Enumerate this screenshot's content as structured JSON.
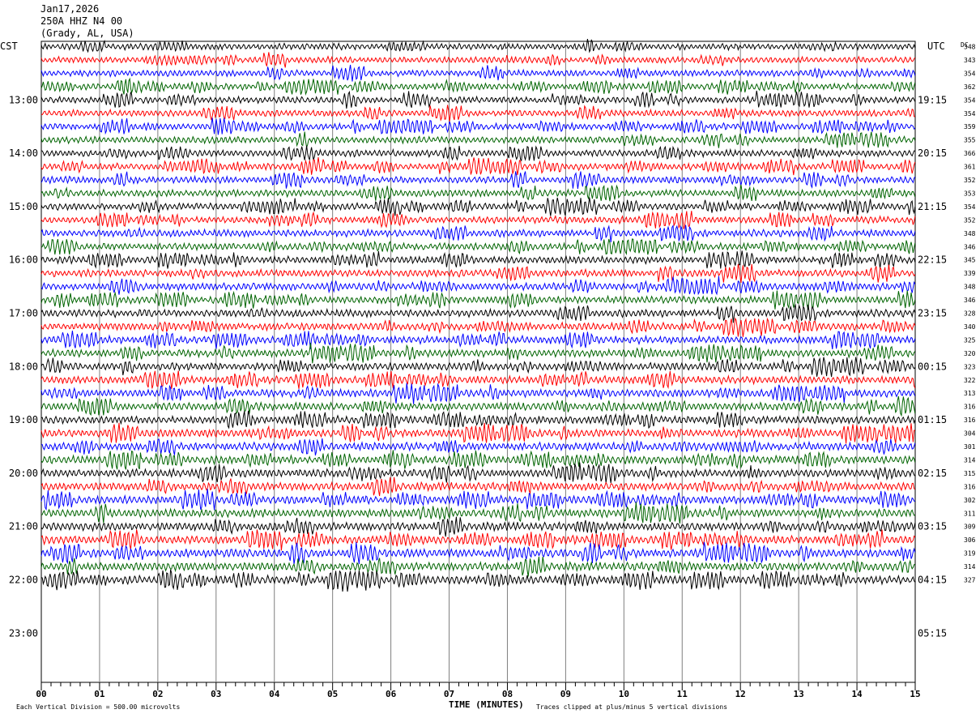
{
  "header": {
    "date": "Jan17,2026",
    "station": "250A HHZ N4 00",
    "location": "(Grady, AL, USA)"
  },
  "chart_data": {
    "type": "line",
    "left_axis_label": "CST",
    "right_axis_label": "UTC",
    "dc_label": "DC",
    "xlabel": "TIME (MINUTES)",
    "x_ticks": [
      "00",
      "01",
      "02",
      "03",
      "04",
      "05",
      "06",
      "07",
      "08",
      "09",
      "10",
      "11",
      "12",
      "13",
      "14",
      "15"
    ],
    "xlim": [
      0,
      15
    ],
    "rows_per_hour": 4,
    "trace_count": 41,
    "left_hour_labels": [
      "13:00",
      "14:00",
      "15:00",
      "16:00",
      "17:00",
      "18:00",
      "19:00",
      "20:00",
      "21:00",
      "22:00",
      "23:00"
    ],
    "right_hour_labels": [
      "19:15",
      "20:15",
      "21:15",
      "22:15",
      "23:15",
      "00:15",
      "01:15",
      "02:15",
      "03:15",
      "04:15",
      "05:15"
    ],
    "trace_colors": [
      "#000000",
      "#ff0000",
      "#0000ff",
      "#006400"
    ],
    "dc_values": [
      "348",
      "343",
      "354",
      "362",
      "354",
      "354",
      "359",
      "355",
      "366",
      "361",
      "352",
      "353",
      "354",
      "352",
      "348",
      "346",
      "345",
      "339",
      "348",
      "346",
      "328",
      "340",
      "325",
      "320",
      "323",
      "322",
      "313",
      "316",
      "316",
      "304",
      "301",
      "314",
      "315",
      "316",
      "302",
      "311",
      "309",
      "306",
      "319",
      "314",
      "327"
    ],
    "footer_left": "Each Vertical Division =  500.00 microvolts",
    "footer_right": "Traces clipped at plus/minus 5 vertical divisions"
  }
}
